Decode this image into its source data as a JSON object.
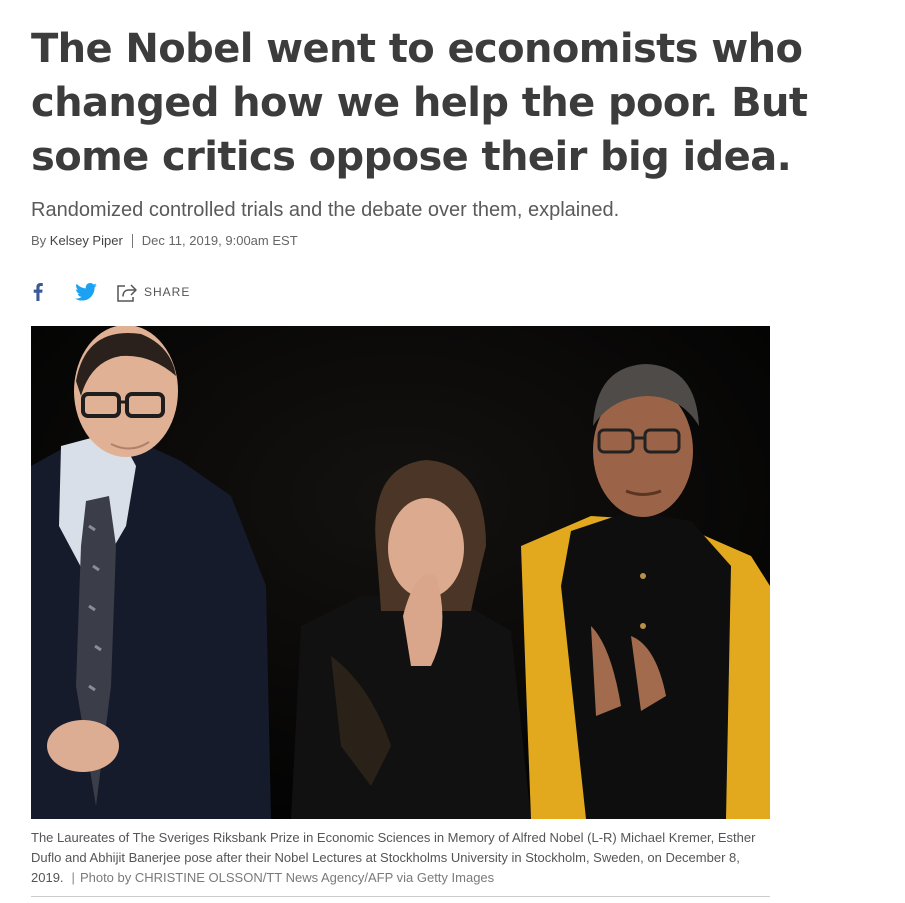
{
  "article": {
    "headline": "The Nobel went to economists who changed how we help the poor. But some critics oppose their big idea.",
    "dek": "Randomized controlled trials and the debate over them, explained.",
    "byline_prefix": "By",
    "author": "Kelsey Piper",
    "date": "Dec 11, 2019, 9:00am EST"
  },
  "share": {
    "facebook_icon": "facebook-icon",
    "twitter_icon": "twitter-icon",
    "share_icon": "share-icon",
    "share_label": "SHARE"
  },
  "colors": {
    "facebook": "#3b5998",
    "twitter": "#1da1f2",
    "headline": "#3c3c3c"
  },
  "photo": {
    "caption": "The Laureates of The Sveriges Riksbank Prize in Economic Sciences in Memory of Alfred Nobel (L-R) Michael Kremer, Esther Duflo and Abhijit Banerjee pose after their Nobel Lectures at Stockholms University in Stockholm, Sweden, on December 8, 2019.",
    "credit": "Photo by CHRISTINE OLSSON/TT News Agency/AFP via Getty Images"
  }
}
